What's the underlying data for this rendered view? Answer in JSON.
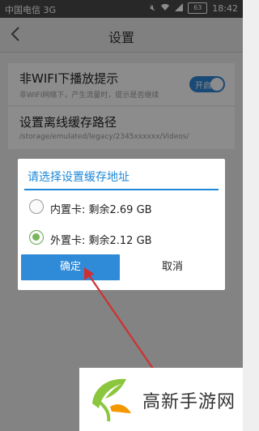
{
  "status_bar": {
    "carrier": "中国电信 3G",
    "battery": "63",
    "time": "18:42"
  },
  "header": {
    "title": "设置"
  },
  "settings": {
    "wifi_prompt": {
      "title": "非WIFI下播放提示",
      "subtitle": "非WIFI网络下，产生流量时，提示是否继续",
      "toggle_label": "开启"
    },
    "cache_path": {
      "title": "设置离线缓存路径",
      "path": "/storage/emulated/legacy/2345xxxxxx/Videos/"
    }
  },
  "dialog": {
    "title": "请选择设置缓存地址",
    "options": [
      {
        "label": "内置卡: 剩余2.69 GB",
        "selected": false
      },
      {
        "label": "外置卡: 剩余2.12 GB",
        "selected": true
      }
    ],
    "confirm_label": "确定",
    "cancel_label": "取消"
  },
  "watermark": {
    "text": "高新手游网"
  },
  "colors": {
    "accent": "#2f8ad8",
    "radio_selected": "#7ab55c",
    "arrow": "#d03030"
  }
}
